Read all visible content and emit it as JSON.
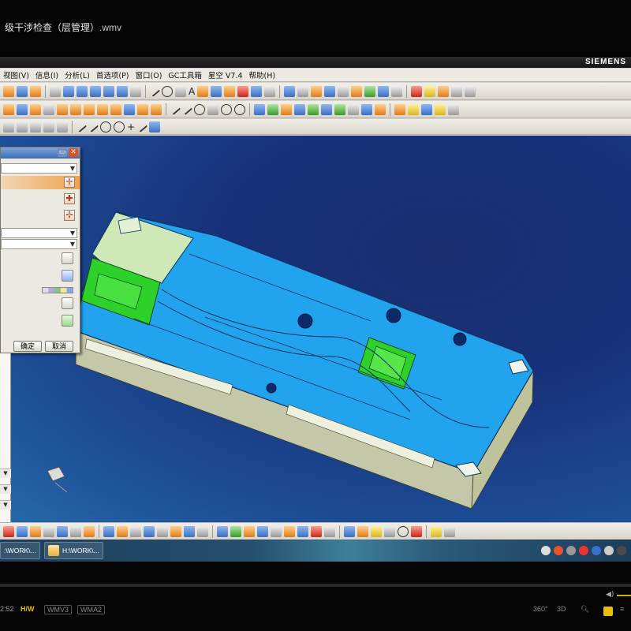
{
  "player": {
    "title_visible": "级干涉检查（层管理）",
    "title_ext": ".wmv",
    "controls": {
      "time": "2:52",
      "hw": "H/W",
      "format1": "WMV3",
      "format2": "WMA2",
      "btn_360": "360°",
      "btn_3d": "3D"
    },
    "accent_color": "#e8c000"
  },
  "app": {
    "brand": "SIEMENS",
    "menu": [
      "视图(V)",
      "信息(I)",
      "分析(L)",
      "首选项(P)",
      "窗口(O)",
      "GC工具箱",
      "星空 V7.4",
      "帮助(H)"
    ],
    "dialog": {
      "ok_label": "确定",
      "cancel_label": "取消",
      "selected_color": "#f0a24f"
    },
    "viewport": {
      "background": "#1d4f97",
      "model_color": "#22a3ee",
      "highlight_color": "#2ed12a"
    }
  },
  "taskbar": {
    "item1": ":\\WORK\\...",
    "item2": "H:\\WORK\\..."
  }
}
